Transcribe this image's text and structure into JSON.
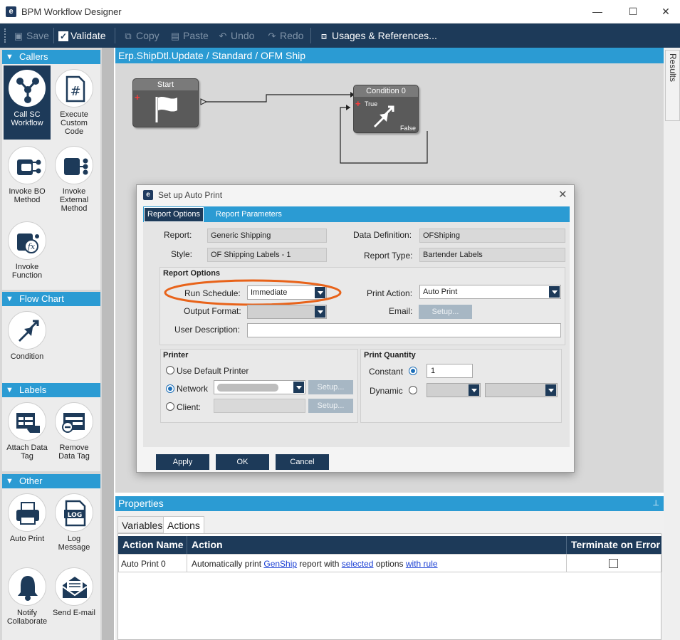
{
  "window": {
    "title": "BPM Workflow Designer",
    "logo_letter": "e",
    "minimize": "—",
    "maximize": "☐",
    "close": "✕"
  },
  "toolbar": {
    "save": "Save",
    "validate": "Validate",
    "copy": "Copy",
    "paste": "Paste",
    "undo": "Undo",
    "redo": "Redo",
    "usages": "Usages & References..."
  },
  "palette": {
    "callers": {
      "header": "Callers",
      "items": [
        {
          "label": "Call SC Workflow",
          "icon": "workflow-icon"
        },
        {
          "label": "Execute Custom Code",
          "icon": "code-file-icon"
        },
        {
          "label": "Invoke BO Method",
          "icon": "bo-method-icon"
        },
        {
          "label": "Invoke External Method",
          "icon": "external-method-icon"
        },
        {
          "label": "Invoke Function",
          "icon": "function-icon"
        }
      ]
    },
    "flowchart": {
      "header": "Flow Chart",
      "items": [
        {
          "label": "Condition",
          "icon": "condition-icon"
        }
      ]
    },
    "labels": {
      "header": "Labels",
      "items": [
        {
          "label": "Attach Data Tag",
          "icon": "attach-tag-icon"
        },
        {
          "label": "Remove Data Tag",
          "icon": "remove-tag-icon"
        }
      ]
    },
    "other": {
      "header": "Other",
      "items": [
        {
          "label": "Auto Print",
          "icon": "printer-icon"
        },
        {
          "label": "Log Message",
          "icon": "log-icon"
        },
        {
          "label": "Notify Collaborate",
          "icon": "bell-icon"
        },
        {
          "label": "Send E-mail",
          "icon": "email-icon"
        }
      ]
    }
  },
  "canvas": {
    "breadcrumb": "Erp.ShipDtl.Update / Standard / OFM Ship",
    "side_tab": "Validation Results",
    "start_node": {
      "title": "Start"
    },
    "condition_node": {
      "title": "Condition 0",
      "true_label": "True",
      "false_label": "False"
    }
  },
  "dialog": {
    "title": "Set up Auto Print",
    "tabs": [
      "Report Options",
      "Report Parameters"
    ],
    "report_label": "Report:",
    "report_value": "Generic Shipping",
    "data_definition_label": "Data Definition:",
    "data_definition_value": "OFShiping",
    "style_label": "Style:",
    "style_value": "OF Shipping Labels - 1",
    "report_type_label": "Report Type:",
    "report_type_value": "Bartender Labels",
    "report_options_header": "Report Options",
    "run_schedule_label": "Run Schedule:",
    "run_schedule_value": "Immediate",
    "print_action_label": "Print Action:",
    "print_action_value": "Auto Print",
    "output_format_label": "Output Format:",
    "output_format_value": "",
    "email_label": "Email:",
    "setup_label": "Setup...",
    "user_description_label": "User Description:",
    "user_description_value": "",
    "printer_header": "Printer",
    "use_default_printer": "Use Default Printer",
    "network_label": "Network",
    "client_label": "Client:",
    "print_quantity_header": "Print Quantity",
    "constant_label": "Constant",
    "constant_value": "1",
    "dynamic_label": "Dynamic",
    "buttons": {
      "apply": "Apply",
      "ok": "OK",
      "cancel": "Cancel"
    },
    "highlight_color": "#e8631a"
  },
  "properties": {
    "header": "Properties",
    "tabs": [
      "Variables",
      "Actions"
    ],
    "columns": [
      "Action Name",
      "Action",
      "Terminate on Error"
    ],
    "row": {
      "name": "Auto Print 0",
      "action_parts": [
        {
          "text": "Automatically print ",
          "link": false
        },
        {
          "text": "GenShip",
          "link": true
        },
        {
          "text": " report with ",
          "link": false
        },
        {
          "text": "selected",
          "link": true
        },
        {
          "text": " options ",
          "link": false
        },
        {
          "text": "with rule",
          "link": true
        }
      ],
      "terminate": false
    }
  },
  "colors": {
    "navy": "#1d3a59",
    "accent_blue": "#2b9bd3",
    "link": "#1a3fd4"
  }
}
